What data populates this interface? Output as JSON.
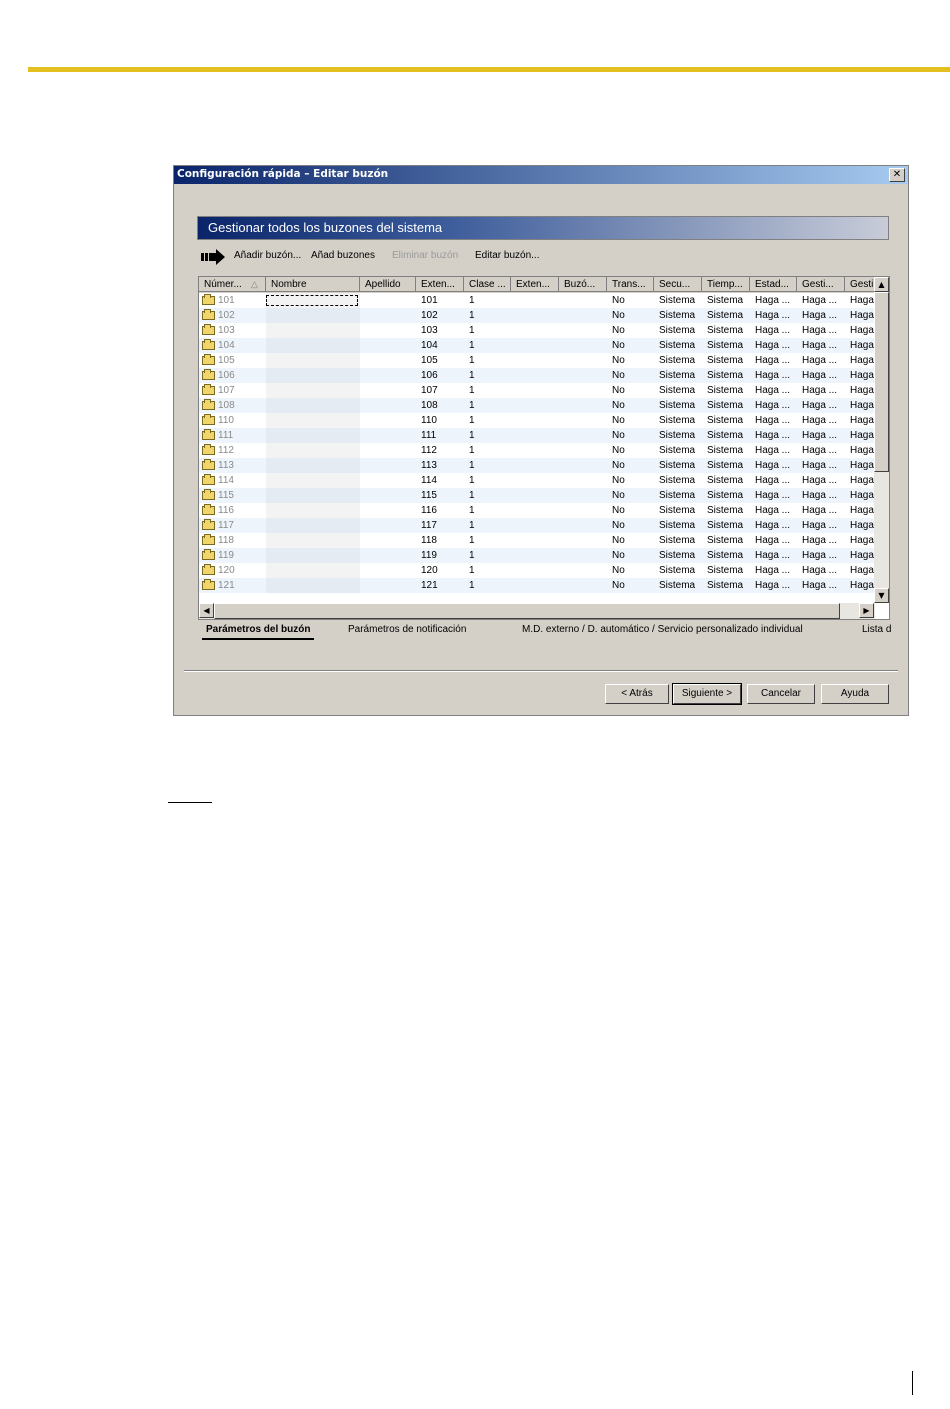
{
  "window": {
    "title": "Configuración rápida – Editar buzón",
    "close_glyph": "✕"
  },
  "section": {
    "title": "Gestionar todos los buzones del sistema"
  },
  "toolbar": {
    "icon": "arrow-right-icon",
    "add_label": "Añadir buzón...",
    "add_multi_label": "Añad buzones",
    "delete_label": "Eliminar buzón",
    "edit_label": "Editar buzón..."
  },
  "table": {
    "columns": [
      "Númer...",
      "Nombre",
      "Apellido",
      "Exten...",
      "Clase ...",
      "Exten...",
      "Buzó...",
      "Trans...",
      "Secu...",
      "Tiemp...",
      "Estad...",
      "Gesti...",
      "Gesti"
    ],
    "rows": [
      [
        "101",
        "",
        "",
        "101",
        "1",
        "",
        "",
        "No",
        "Sistema",
        "Sistema",
        "Haga ...",
        "Haga ...",
        "Haga"
      ],
      [
        "102",
        "",
        "",
        "102",
        "1",
        "",
        "",
        "No",
        "Sistema",
        "Sistema",
        "Haga ...",
        "Haga ...",
        "Haga"
      ],
      [
        "103",
        "",
        "",
        "103",
        "1",
        "",
        "",
        "No",
        "Sistema",
        "Sistema",
        "Haga ...",
        "Haga ...",
        "Haga"
      ],
      [
        "104",
        "",
        "",
        "104",
        "1",
        "",
        "",
        "No",
        "Sistema",
        "Sistema",
        "Haga ...",
        "Haga ...",
        "Haga"
      ],
      [
        "105",
        "",
        "",
        "105",
        "1",
        "",
        "",
        "No",
        "Sistema",
        "Sistema",
        "Haga ...",
        "Haga ...",
        "Haga"
      ],
      [
        "106",
        "",
        "",
        "106",
        "1",
        "",
        "",
        "No",
        "Sistema",
        "Sistema",
        "Haga ...",
        "Haga ...",
        "Haga"
      ],
      [
        "107",
        "",
        "",
        "107",
        "1",
        "",
        "",
        "No",
        "Sistema",
        "Sistema",
        "Haga ...",
        "Haga ...",
        "Haga"
      ],
      [
        "108",
        "",
        "",
        "108",
        "1",
        "",
        "",
        "No",
        "Sistema",
        "Sistema",
        "Haga ...",
        "Haga ...",
        "Haga"
      ],
      [
        "110",
        "",
        "",
        "110",
        "1",
        "",
        "",
        "No",
        "Sistema",
        "Sistema",
        "Haga ...",
        "Haga ...",
        "Haga"
      ],
      [
        "111",
        "",
        "",
        "111",
        "1",
        "",
        "",
        "No",
        "Sistema",
        "Sistema",
        "Haga ...",
        "Haga ...",
        "Haga"
      ],
      [
        "112",
        "",
        "",
        "112",
        "1",
        "",
        "",
        "No",
        "Sistema",
        "Sistema",
        "Haga ...",
        "Haga ...",
        "Haga"
      ],
      [
        "113",
        "",
        "",
        "113",
        "1",
        "",
        "",
        "No",
        "Sistema",
        "Sistema",
        "Haga ...",
        "Haga ...",
        "Haga"
      ],
      [
        "114",
        "",
        "",
        "114",
        "1",
        "",
        "",
        "No",
        "Sistema",
        "Sistema",
        "Haga ...",
        "Haga ...",
        "Haga"
      ],
      [
        "115",
        "",
        "",
        "115",
        "1",
        "",
        "",
        "No",
        "Sistema",
        "Sistema",
        "Haga ...",
        "Haga ...",
        "Haga"
      ],
      [
        "116",
        "",
        "",
        "116",
        "1",
        "",
        "",
        "No",
        "Sistema",
        "Sistema",
        "Haga ...",
        "Haga ...",
        "Haga"
      ],
      [
        "117",
        "",
        "",
        "117",
        "1",
        "",
        "",
        "No",
        "Sistema",
        "Sistema",
        "Haga ...",
        "Haga ...",
        "Haga"
      ],
      [
        "118",
        "",
        "",
        "118",
        "1",
        "",
        "",
        "No",
        "Sistema",
        "Sistema",
        "Haga ...",
        "Haga ...",
        "Haga"
      ],
      [
        "119",
        "",
        "",
        "119",
        "1",
        "",
        "",
        "No",
        "Sistema",
        "Sistema",
        "Haga ...",
        "Haga ...",
        "Haga"
      ],
      [
        "120",
        "",
        "",
        "120",
        "1",
        "",
        "",
        "No",
        "Sistema",
        "Sistema",
        "Haga ...",
        "Haga ...",
        "Haga"
      ],
      [
        "121",
        "",
        "",
        "121",
        "1",
        "",
        "",
        "No",
        "Sistema",
        "Sistema",
        "Haga ...",
        "Haga ...",
        "Haga"
      ]
    ],
    "sort_glyph": "△",
    "scroll_up": "▲",
    "scroll_down": "▼",
    "scroll_left": "◀",
    "scroll_right": "▶"
  },
  "tabs": [
    "Parámetros del buzón",
    "Parámetros de notificación",
    "M.D. externo / D. automático / Servicio personalizado individual",
    "Lista d"
  ],
  "buttons": {
    "back": "< Atrás",
    "next": "Siguiente >",
    "cancel": "Cancelar",
    "help": "Ayuda"
  }
}
